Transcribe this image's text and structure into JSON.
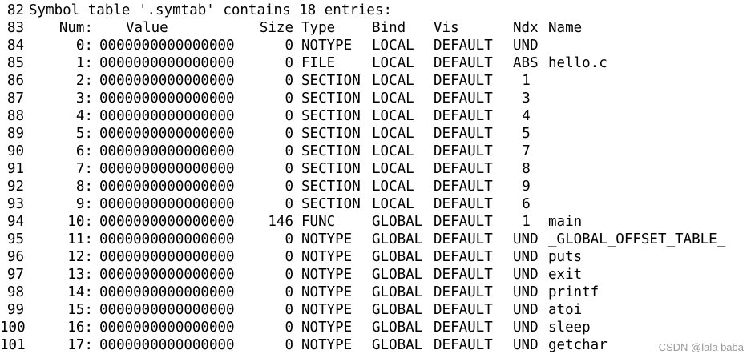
{
  "header_line": {
    "line_no": "82",
    "text": "Symbol table '.symtab' contains 18 entries:"
  },
  "columns_line": {
    "line_no": "83",
    "num": "Num:",
    "value": "Value",
    "size": "Size",
    "type": "Type",
    "bind": "Bind",
    "vis": "Vis",
    "ndx": "Ndx",
    "name": "Name"
  },
  "rows": [
    {
      "line_no": "84",
      "num": "0:",
      "value": "0000000000000000",
      "size": "0",
      "type": "NOTYPE",
      "bind": "LOCAL",
      "vis": "DEFAULT",
      "ndx": "UND",
      "name": ""
    },
    {
      "line_no": "85",
      "num": "1:",
      "value": "0000000000000000",
      "size": "0",
      "type": "FILE",
      "bind": "LOCAL",
      "vis": "DEFAULT",
      "ndx": "ABS",
      "name": "hello.c"
    },
    {
      "line_no": "86",
      "num": "2:",
      "value": "0000000000000000",
      "size": "0",
      "type": "SECTION",
      "bind": "LOCAL",
      "vis": "DEFAULT",
      "ndx": "1",
      "name": ""
    },
    {
      "line_no": "87",
      "num": "3:",
      "value": "0000000000000000",
      "size": "0",
      "type": "SECTION",
      "bind": "LOCAL",
      "vis": "DEFAULT",
      "ndx": "3",
      "name": ""
    },
    {
      "line_no": "88",
      "num": "4:",
      "value": "0000000000000000",
      "size": "0",
      "type": "SECTION",
      "bind": "LOCAL",
      "vis": "DEFAULT",
      "ndx": "4",
      "name": ""
    },
    {
      "line_no": "89",
      "num": "5:",
      "value": "0000000000000000",
      "size": "0",
      "type": "SECTION",
      "bind": "LOCAL",
      "vis": "DEFAULT",
      "ndx": "5",
      "name": ""
    },
    {
      "line_no": "90",
      "num": "6:",
      "value": "0000000000000000",
      "size": "0",
      "type": "SECTION",
      "bind": "LOCAL",
      "vis": "DEFAULT",
      "ndx": "7",
      "name": ""
    },
    {
      "line_no": "91",
      "num": "7:",
      "value": "0000000000000000",
      "size": "0",
      "type": "SECTION",
      "bind": "LOCAL",
      "vis": "DEFAULT",
      "ndx": "8",
      "name": ""
    },
    {
      "line_no": "92",
      "num": "8:",
      "value": "0000000000000000",
      "size": "0",
      "type": "SECTION",
      "bind": "LOCAL",
      "vis": "DEFAULT",
      "ndx": "9",
      "name": ""
    },
    {
      "line_no": "93",
      "num": "9:",
      "value": "0000000000000000",
      "size": "0",
      "type": "SECTION",
      "bind": "LOCAL",
      "vis": "DEFAULT",
      "ndx": "6",
      "name": ""
    },
    {
      "line_no": "94",
      "num": "10:",
      "value": "0000000000000000",
      "size": "146",
      "type": "FUNC",
      "bind": "GLOBAL",
      "vis": "DEFAULT",
      "ndx": "1",
      "name": "main"
    },
    {
      "line_no": "95",
      "num": "11:",
      "value": "0000000000000000",
      "size": "0",
      "type": "NOTYPE",
      "bind": "GLOBAL",
      "vis": "DEFAULT",
      "ndx": "UND",
      "name": "_GLOBAL_OFFSET_TABLE_"
    },
    {
      "line_no": "96",
      "num": "12:",
      "value": "0000000000000000",
      "size": "0",
      "type": "NOTYPE",
      "bind": "GLOBAL",
      "vis": "DEFAULT",
      "ndx": "UND",
      "name": "puts"
    },
    {
      "line_no": "97",
      "num": "13:",
      "value": "0000000000000000",
      "size": "0",
      "type": "NOTYPE",
      "bind": "GLOBAL",
      "vis": "DEFAULT",
      "ndx": "UND",
      "name": "exit"
    },
    {
      "line_no": "98",
      "num": "14:",
      "value": "0000000000000000",
      "size": "0",
      "type": "NOTYPE",
      "bind": "GLOBAL",
      "vis": "DEFAULT",
      "ndx": "UND",
      "name": "printf"
    },
    {
      "line_no": "99",
      "num": "15:",
      "value": "0000000000000000",
      "size": "0",
      "type": "NOTYPE",
      "bind": "GLOBAL",
      "vis": "DEFAULT",
      "ndx": "UND",
      "name": "atoi"
    },
    {
      "line_no": "100",
      "num": "16:",
      "value": "0000000000000000",
      "size": "0",
      "type": "NOTYPE",
      "bind": "GLOBAL",
      "vis": "DEFAULT",
      "ndx": "UND",
      "name": "sleep"
    },
    {
      "line_no": "101",
      "num": "17:",
      "value": "0000000000000000",
      "size": "0",
      "type": "NOTYPE",
      "bind": "GLOBAL",
      "vis": "DEFAULT",
      "ndx": "UND",
      "name": "getchar"
    }
  ],
  "watermark": "CSDN @lala baba"
}
